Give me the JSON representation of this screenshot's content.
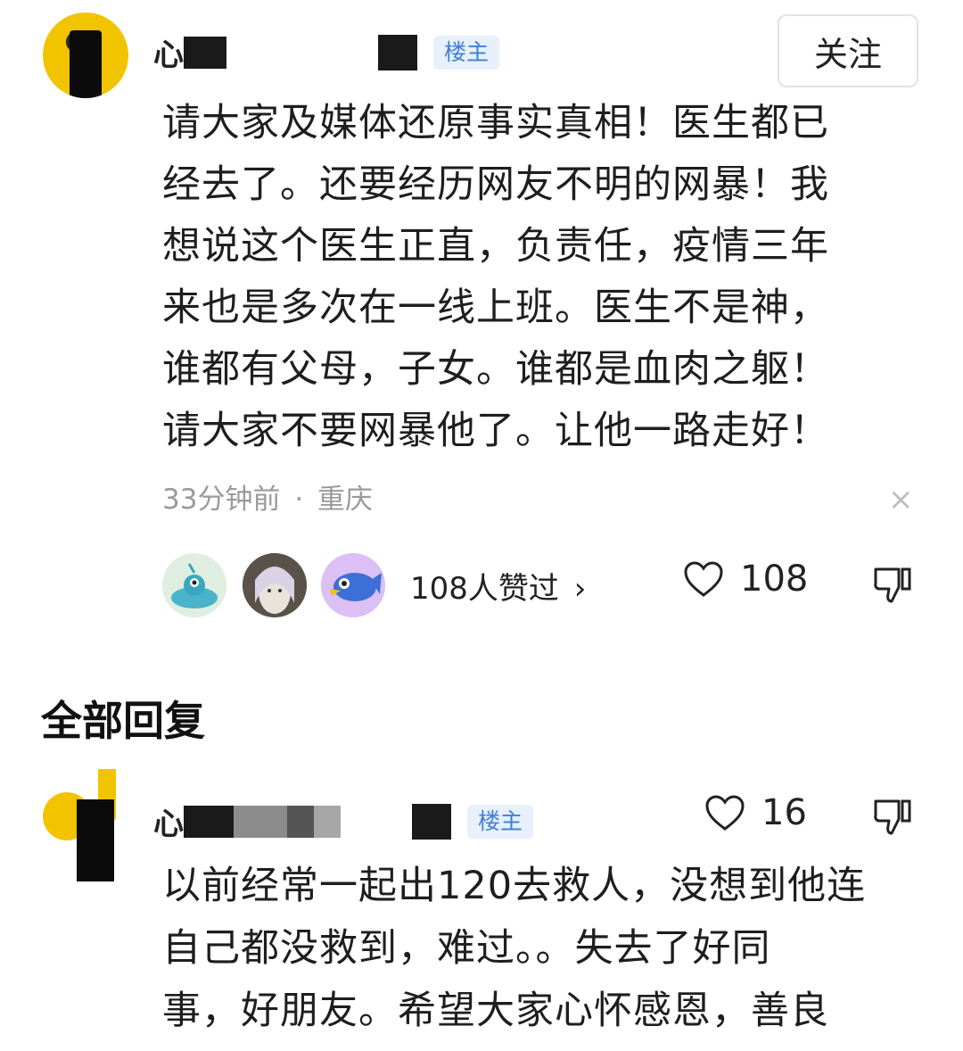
{
  "post": {
    "username_visible": "心",
    "badge": "楼主",
    "follow_label": "关注",
    "content": "请大家及媒体还原事实真相！医生都已经去了。还要经历网友不明的网暴！我想说这个医生正直，负责任，疫情三年来也是多次在一线上班。医生不是神，谁都有父母，子女。谁都是血肉之躯！请大家不要网暴他了。让他一路走好！",
    "lines": [
      "请大家及媒体还原事实真相！医生都已",
      "经去了。还要经历网友不明的网暴！我",
      "想说这个医生正直，负责任，疫情三年",
      "来也是多次在一线上班。医生不是神，",
      "谁都有父母，子女。谁都是血肉之躯！",
      "请大家不要网暴他了。让他一路走好！"
    ],
    "time": "33分钟前",
    "separator": "·",
    "location": "重庆",
    "close_icon": "×",
    "likers_summary": "108人赞过",
    "likers_chevron": "›",
    "like_count": "108"
  },
  "section": {
    "title": "全部回复"
  },
  "reply": {
    "username_visible": "心",
    "badge": "楼主",
    "like_count": "16",
    "lines": [
      "以前经常一起出120去救人，没想到他连",
      "自己都没救到，难过。。失去了好同",
      "事，好朋友。希望大家心怀感恩，善良"
    ]
  },
  "colors": {
    "badge_bg": "#e7f0fb",
    "badge_text": "#3e7fd6",
    "meta_text": "#9a9a9a",
    "avatar_yellow": "#f2c400"
  }
}
